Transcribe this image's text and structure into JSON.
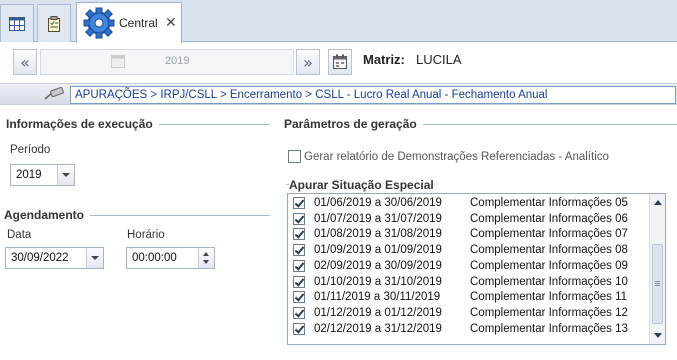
{
  "tabs": {
    "active_label": "Central",
    "close_symbol": "✕"
  },
  "toolbar": {
    "prev_symbol": "«",
    "next_symbol": "»",
    "year": "2019",
    "matriz_label": "Matriz:",
    "matriz_value": "LUCILA"
  },
  "breadcrumb": {
    "path": "APURAÇÕES > IRPJ/CSLL > Encerramento > CSLL - Lucro Real Anual - Fechamento Anual"
  },
  "execucao": {
    "title": "Informações de execução",
    "periodo_label": "Período",
    "periodo_value": "2019"
  },
  "agendamento": {
    "title": "Agendamento",
    "data_label": "Data",
    "data_value": "30/09/2022",
    "horario_label": "Horário",
    "horario_value": "00:00:00"
  },
  "geracao": {
    "title": "Parâmetros de geração",
    "gerar_label": "Gerar relatório de Demonstrações Referenciadas - Analítico",
    "gerar_checked": false,
    "situacao_title": "Apurar Situação Especial",
    "items": [
      {
        "period": "01/06/2019 a 30/06/2019",
        "desc": "Complementar Informações 05",
        "checked": true
      },
      {
        "period": "01/07/2019 a 31/07/2019",
        "desc": "Complementar Informações 06",
        "checked": true
      },
      {
        "period": "01/08/2019 a 31/08/2019",
        "desc": "Complementar Informações 07",
        "checked": true
      },
      {
        "period": "01/09/2019 a 01/09/2019",
        "desc": "Complementar Informações 08",
        "checked": true
      },
      {
        "period": "02/09/2019 a 30/09/2019",
        "desc": "Complementar Informações 09",
        "checked": true
      },
      {
        "period": "01/10/2019 a 31/10/2019",
        "desc": "Complementar Informações 10",
        "checked": true
      },
      {
        "period": "01/11/2019 a 30/11/2019",
        "desc": "Complementar Informações 11",
        "checked": true
      },
      {
        "period": "01/12/2019 a 01/12/2019",
        "desc": "Complementar Informações 12",
        "checked": true
      },
      {
        "period": "02/12/2019 a 31/12/2019",
        "desc": "Complementar Informações 13",
        "checked": true
      }
    ]
  }
}
